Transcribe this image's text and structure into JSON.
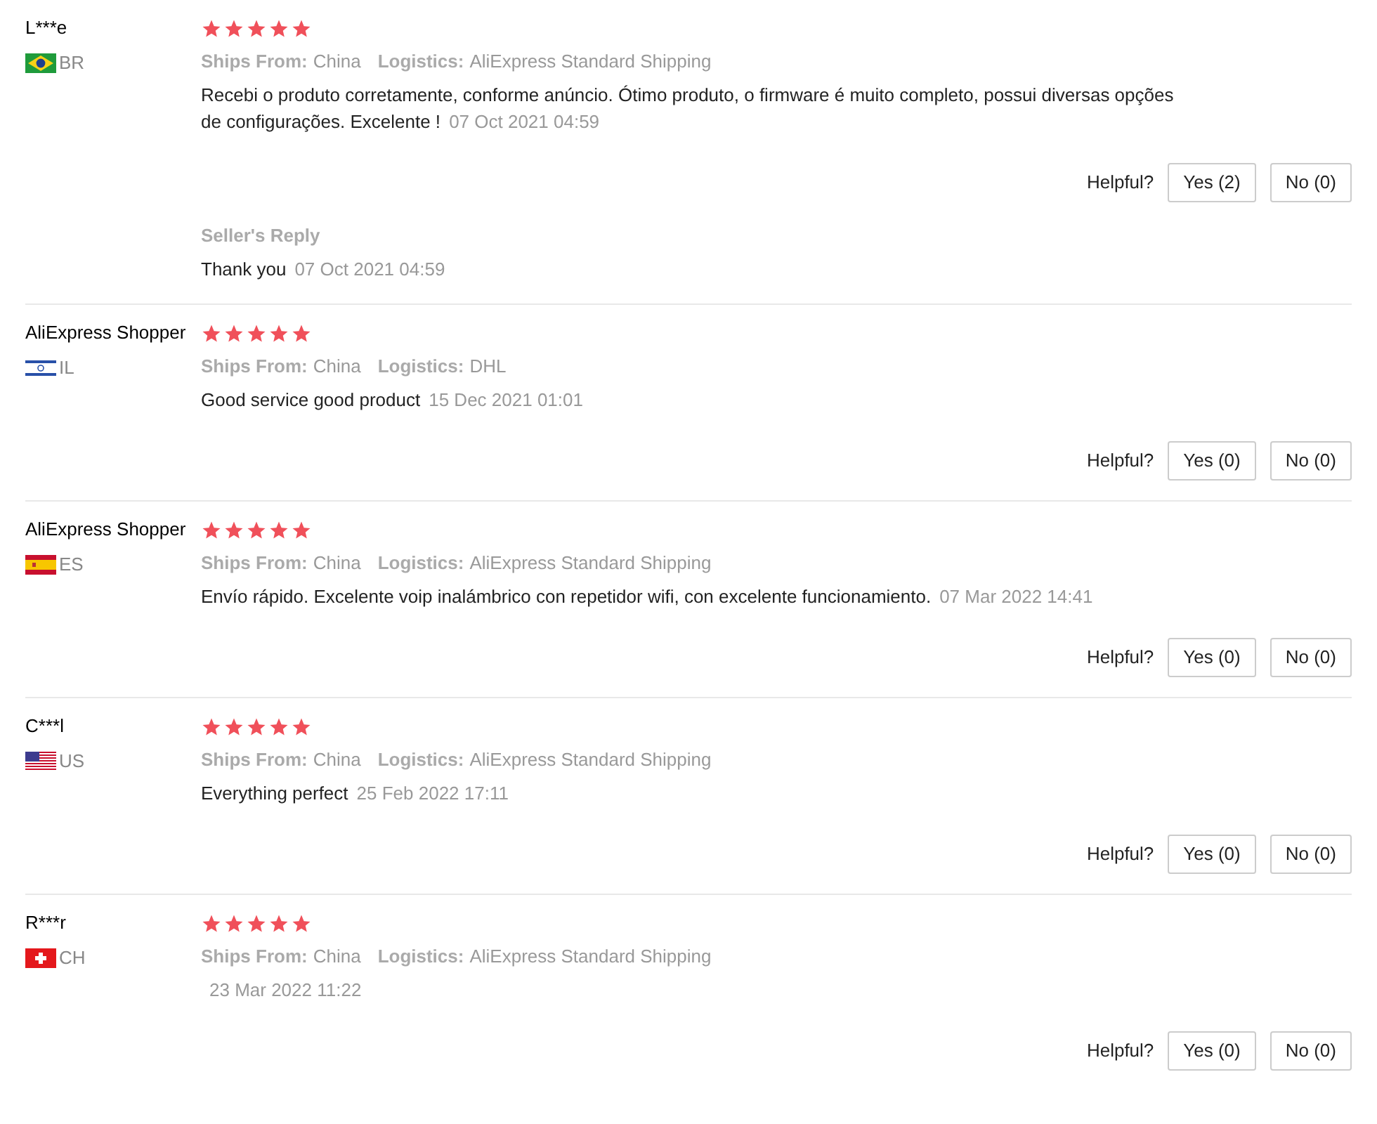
{
  "reviews": [
    {
      "user": "L***e",
      "country": "BR",
      "stars": 5,
      "ships_from_label": "Ships From:",
      "ships_from": "China",
      "logistics_label": "Logistics:",
      "logistics": "AliExpress Standard Shipping",
      "text": "Recebi o produto corretamente, conforme anúncio. Ótimo produto, o firmware é muito completo, possui diversas opções de configurações. Excelente !",
      "date": "07 Oct 2021 04:59",
      "helpful_label": "Helpful?",
      "yes": "Yes (2)",
      "no": "No (0)",
      "seller_reply": {
        "label": "Seller's Reply",
        "text": "Thank you",
        "date": "07 Oct 2021 04:59"
      }
    },
    {
      "user": "AliExpress Shopper",
      "country": "IL",
      "stars": 5,
      "ships_from_label": "Ships From:",
      "ships_from": "China",
      "logistics_label": "Logistics:",
      "logistics": "DHL",
      "text": "Good service good product",
      "date": "15 Dec 2021 01:01",
      "helpful_label": "Helpful?",
      "yes": "Yes (0)",
      "no": "No (0)"
    },
    {
      "user": "AliExpress Shopper",
      "country": "ES",
      "stars": 5,
      "ships_from_label": "Ships From:",
      "ships_from": "China",
      "logistics_label": "Logistics:",
      "logistics": "AliExpress Standard Shipping",
      "text": "Envío rápido. Excelente voip inalámbrico con repetidor wifi, con excelente funcionamiento.",
      "date": "07 Mar 2022 14:41",
      "helpful_label": "Helpful?",
      "yes": "Yes (0)",
      "no": "No (0)"
    },
    {
      "user": "C***l",
      "country": "US",
      "stars": 5,
      "ships_from_label": "Ships From:",
      "ships_from": "China",
      "logistics_label": "Logistics:",
      "logistics": "AliExpress Standard Shipping",
      "text": "Everything perfect",
      "date": "25 Feb 2022 17:11",
      "helpful_label": "Helpful?",
      "yes": "Yes (0)",
      "no": "No (0)"
    },
    {
      "user": "R***r",
      "country": "CH",
      "stars": 5,
      "ships_from_label": "Ships From:",
      "ships_from": "China",
      "logistics_label": "Logistics:",
      "logistics": "AliExpress Standard Shipping",
      "date": "23 Mar 2022 11:22",
      "helpful_label": "Helpful?",
      "yes": "Yes (0)",
      "no": "No (0)"
    }
  ]
}
